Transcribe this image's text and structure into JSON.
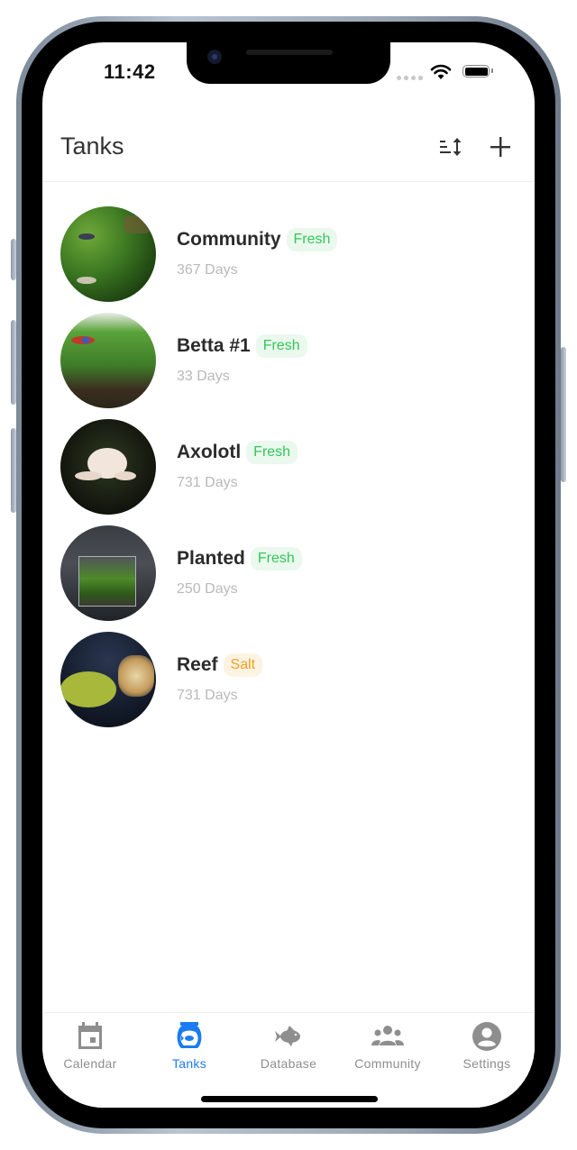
{
  "status_bar": {
    "time": "11:42"
  },
  "header": {
    "title": "Tanks",
    "sort_icon": "sort-icon",
    "add_icon": "plus-icon"
  },
  "tanks": [
    {
      "name": "Community",
      "type": "Fresh",
      "days": "367 Days",
      "image": "planted-community-tank-photo"
    },
    {
      "name": "Betta #1",
      "type": "Fresh",
      "days": "33 Days",
      "image": "betta-tank-photo"
    },
    {
      "name": "Axolotl",
      "type": "Fresh",
      "days": "731 Days",
      "image": "axolotl-photo"
    },
    {
      "name": "Planted",
      "type": "Fresh",
      "days": "250 Days",
      "image": "planted-cube-tank-photo"
    },
    {
      "name": "Reef",
      "type": "Salt",
      "days": "731 Days",
      "image": "reef-coral-photo"
    }
  ],
  "tab_bar": {
    "items": [
      {
        "label": "Calendar",
        "icon": "calendar-icon",
        "active": false
      },
      {
        "label": "Tanks",
        "icon": "fishbowl-icon",
        "active": true
      },
      {
        "label": "Database",
        "icon": "fish-icon",
        "active": false
      },
      {
        "label": "Community",
        "icon": "people-icon",
        "active": false
      },
      {
        "label": "Settings",
        "icon": "account-circle-icon",
        "active": false
      }
    ]
  },
  "colors": {
    "accent": "#1a7cf0",
    "fresh": "#34c759",
    "fresh_bg": "#eaf8ee",
    "salt": "#f2a11f",
    "salt_bg": "#fdf3e3",
    "inactive": "#8e8e8e"
  }
}
